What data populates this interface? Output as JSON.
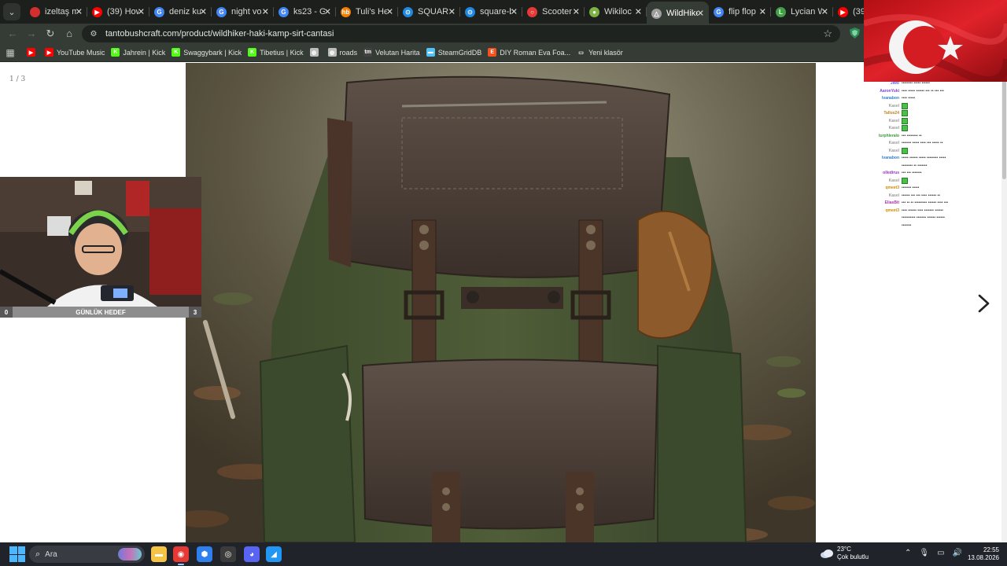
{
  "tabs": [
    {
      "title": "izeltaş m",
      "icon_color": "#d32f2f",
      "icon_text": "",
      "active": false
    },
    {
      "title": "(39) How",
      "icon_color": "#ff0000",
      "icon_text": "▶",
      "active": false
    },
    {
      "title": "deniz ku",
      "icon_color": "#4285f4",
      "icon_text": "G",
      "active": false
    },
    {
      "title": "night vo",
      "icon_color": "#4285f4",
      "icon_text": "G",
      "active": false
    },
    {
      "title": "ks23 - G",
      "icon_color": "#4285f4",
      "icon_text": "G",
      "active": false
    },
    {
      "title": "Tuli's He",
      "icon_color": "#f57c00",
      "icon_text": "hb",
      "active": false
    },
    {
      "title": "SQUARE",
      "icon_color": "#1e88e5",
      "icon_text": "⊙",
      "active": false
    },
    {
      "title": "square-b",
      "icon_color": "#1e88e5",
      "icon_text": "⊙",
      "active": false
    },
    {
      "title": "Scooter",
      "icon_color": "#e53935",
      "icon_text": "○",
      "active": false
    },
    {
      "title": "Wikiloc",
      "icon_color": "#7cb342",
      "icon_text": "●",
      "active": false
    },
    {
      "title": "WildHike",
      "icon_color": "#9e9e9e",
      "icon_text": "△",
      "active": true
    },
    {
      "title": "flip flop",
      "icon_color": "#4285f4",
      "icon_text": "G",
      "active": false
    },
    {
      "title": "Lycian W",
      "icon_color": "#43a047",
      "icon_text": "L",
      "active": false
    },
    {
      "title": "(39) I",
      "icon_color": "#ff0000",
      "icon_text": "▶",
      "active": false
    }
  ],
  "toolbar": {
    "url": "tantobushcraft.com/product/wildhiker-haki-kamp-sirt-cantasi"
  },
  "bookmarks": [
    {
      "label": "",
      "icon_color": "#ff0000",
      "icon_text": "▶"
    },
    {
      "label": "YouTube Music",
      "icon_color": "#ff0000",
      "icon_text": "▶"
    },
    {
      "label": "Jahrein | Kick",
      "icon_color": "#53fc18",
      "icon_text": "K"
    },
    {
      "label": "Swaggybark | Kick",
      "icon_color": "#53fc18",
      "icon_text": "K"
    },
    {
      "label": "Tibetius | Kick",
      "icon_color": "#53fc18",
      "icon_text": "K"
    },
    {
      "label": "",
      "icon_color": "#bdbdbd",
      "icon_text": "◍"
    },
    {
      "label": "roads",
      "icon_color": "#bdbdbd",
      "icon_text": "◍"
    },
    {
      "label": "Velutan Harita",
      "icon_color": "#424242",
      "icon_text": "tm"
    },
    {
      "label": "SteamGridDB",
      "icon_color": "#4fc3f7",
      "icon_text": "▬"
    },
    {
      "label": "DIY Roman Eva Foa...",
      "icon_color": "#f4511e",
      "icon_text": "E"
    },
    {
      "label": "Yeni klasör",
      "icon_color": "#353c35",
      "icon_text": "▭"
    }
  ],
  "page": {
    "slide_counter": "1 / 3",
    "next_label": "Next image"
  },
  "stream": {
    "goal_label": "GÜNLÜK HEDEF",
    "goal_min": "0",
    "goal_max": "3",
    "chat": [
      {
        "user": "Jiwo",
        "color": "#5a5aff",
        "msg": "•••••••• ••••• ••••••"
      },
      {
        "user": "AaronYuki",
        "color": "#7b3fe4",
        "msg": "•••• ••••• •••••• ••• •• ••• •••"
      },
      {
        "user": "Ivanabon",
        "color": "#2d7fd0",
        "msg": "•••• •••••"
      },
      {
        "user": "Kasel",
        "color": "#999999",
        "msg": "",
        "emote": true
      },
      {
        "user": "Tallos24",
        "color": "#c08020",
        "msg": "",
        "emote": true
      },
      {
        "user": "Kasel",
        "color": "#999999",
        "msg": "",
        "emote": true
      },
      {
        "user": "Kasel",
        "color": "#999999",
        "msg": "",
        "emote": true
      },
      {
        "user": "turphleralo",
        "color": "#3a9a3a",
        "msg": "••• •••••••• ••"
      },
      {
        "user": "Kasel",
        "color": "#999999",
        "msg": "••••••• ••••• •••• ••• ••••• ••"
      },
      {
        "user": "Kasel",
        "color": "#999999",
        "msg": "",
        "emote": true
      },
      {
        "user": "Ivanabon",
        "color": "#2d7fd0",
        "msg": "••••• •••••• ••••• •••••••• •••••"
      },
      {
        "user": "",
        "color": "#999999",
        "msg": "•••••••• •• •••••••"
      },
      {
        "user": "olledirus",
        "color": "#9a2fc0",
        "msg": "••• ••• •••••••"
      },
      {
        "user": "Kasel",
        "color": "#999999",
        "msg": "",
        "emote": true
      },
      {
        "user": "qmeet3",
        "color": "#d08a00",
        "msg": "••••••• •••••"
      },
      {
        "user": "Kasel",
        "color": "#999999",
        "msg": "•••••• ••• ••• •••• •••••• ••"
      },
      {
        "user": "EliasBit",
        "color": "#b02fb0",
        "msg": "••• •• •• ••••••••• •••••• •••• •••"
      },
      {
        "user": "qmeet3",
        "color": "#d08a00",
        "msg": "•••• •••••• •••• ••••••• ••••••"
      },
      {
        "user": "",
        "color": "#999999",
        "msg": "•••••••••• ••••••• •••••• ••••••"
      },
      {
        "user": "",
        "color": "#999999",
        "msg": "•••••••"
      }
    ]
  },
  "taskbar": {
    "search_placeholder": "Ara",
    "apps": [
      {
        "name": "file-explorer-icon",
        "color": "#f6c445",
        "glyph": "▬",
        "active": false
      },
      {
        "name": "chrome-icon",
        "color": "#e53935",
        "glyph": "◉",
        "active": true
      },
      {
        "name": "app-hex-icon",
        "color": "#2f80ed",
        "glyph": "⬢",
        "active": false
      },
      {
        "name": "obs-icon",
        "color": "#3b3b3b",
        "glyph": "◎",
        "active": false
      },
      {
        "name": "discord-icon",
        "color": "#5865f2",
        "glyph": "◕",
        "active": false
      },
      {
        "name": "app-blue-icon",
        "color": "#2196f3",
        "glyph": "◢",
        "active": false
      }
    ],
    "weather_temp": "23°C",
    "weather_desc": "Çok bulutlu",
    "time": "22:55",
    "date": "13.08.2026"
  }
}
